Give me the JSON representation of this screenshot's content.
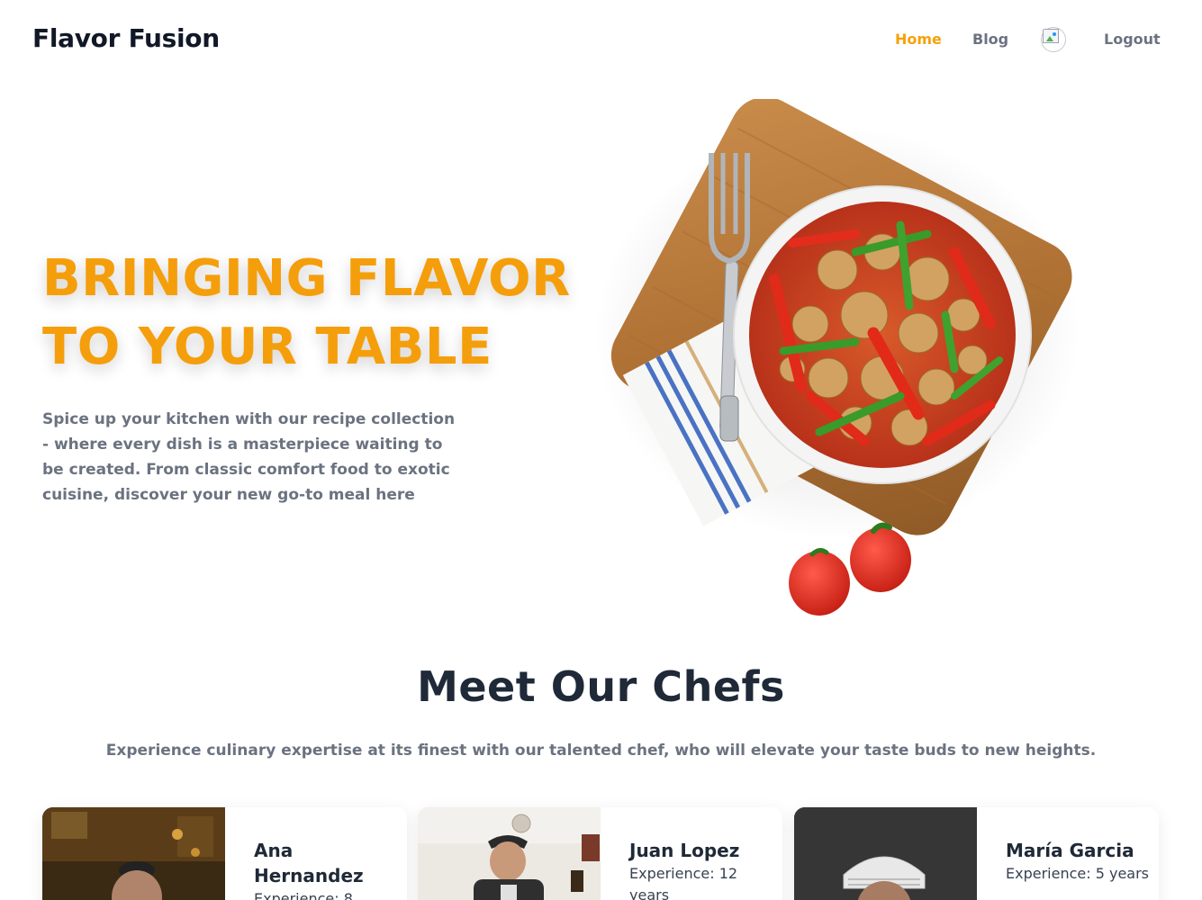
{
  "header": {
    "brand": "Flavor Fusion",
    "nav": {
      "home": "Home",
      "blog": "Blog",
      "logout": "Logout"
    },
    "active_color": "#f6a10a"
  },
  "hero": {
    "title_line1": "BRINGING FLAVOR",
    "title_line2": "TO YOUR TABLE",
    "description": "Spice up your kitchen with our recipe collection - where every dish is a masterpiece waiting to be created. From classic comfort food to exotic cuisine, discover your new go-to meal here",
    "accent_color": "#f59e0b"
  },
  "chefs_section": {
    "title": "Meet Our Chefs",
    "subtitle": "Experience culinary expertise at its finest with our talented chef, who will elevate your taste buds to new heights.",
    "chefs": [
      {
        "name": "Ana Hernandez",
        "experience": "Experience: 8"
      },
      {
        "name": "Juan Lopez",
        "experience": "Experience: 12 years"
      },
      {
        "name": "María Garcia",
        "experience": "Experience: 5 years"
      }
    ]
  }
}
